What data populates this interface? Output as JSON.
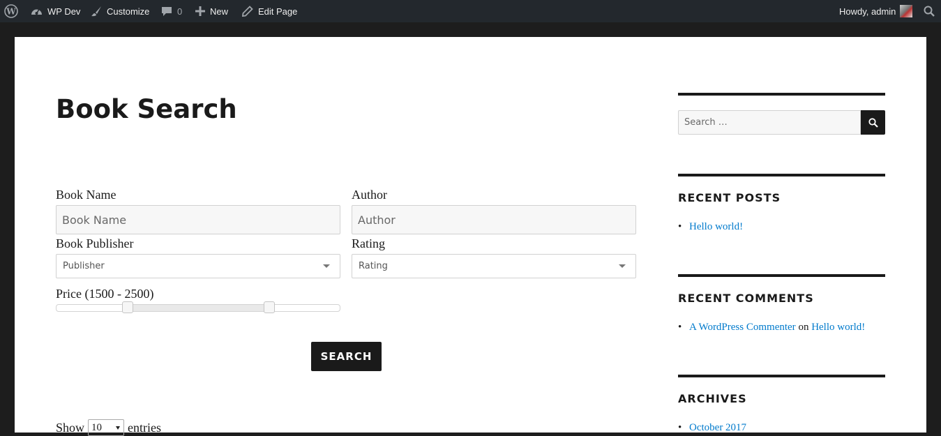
{
  "admin_bar": {
    "site_name": "WP Dev",
    "customize": "Customize",
    "comments_count": "0",
    "new": "New",
    "edit_page": "Edit Page",
    "howdy": "Howdy, admin"
  },
  "page": {
    "title": "Book Search"
  },
  "form": {
    "book_name_label": "Book Name",
    "book_name_placeholder": "Book Name",
    "author_label": "Author",
    "author_placeholder": "Author",
    "publisher_label": "Book Publisher",
    "publisher_selected": "Publisher",
    "rating_label": "Rating",
    "rating_selected": "Rating",
    "price_label": "Price (1500 - 2500)",
    "price_slider": {
      "min": 1000,
      "max": 3000,
      "low": 1500,
      "high": 2500
    },
    "search_button": "SEARCH"
  },
  "table_controls": {
    "show": "Show",
    "entries_value": "10",
    "entries": "entries"
  },
  "sidebar": {
    "search_placeholder": "Search …",
    "recent_posts_title": "RECENT POSTS",
    "recent_posts": [
      "Hello world!"
    ],
    "recent_comments_title": "RECENT COMMENTS",
    "recent_comment": {
      "author": "A WordPress Commenter",
      "on": "on",
      "post": "Hello world!"
    },
    "archives_title": "ARCHIVES",
    "archives": [
      "October 2017"
    ]
  },
  "colors": {
    "admin_bar": "#23282d",
    "link": "#007acc",
    "text": "#1a1a1a"
  }
}
